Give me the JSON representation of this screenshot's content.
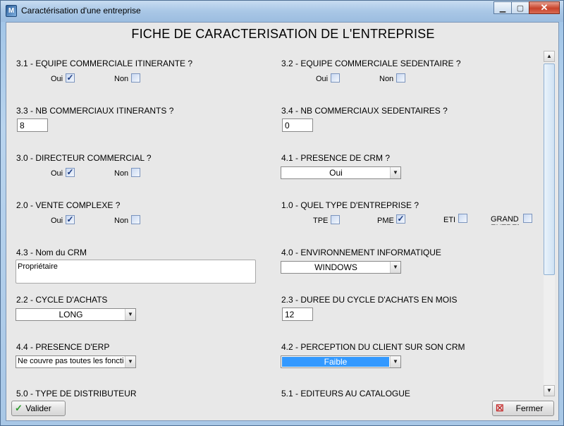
{
  "window": {
    "title": "Caractérisation d'une entreprise",
    "app_icon_text": "M"
  },
  "heading": "FICHE DE CARACTERISATION DE L'ENTREPRISE",
  "common": {
    "oui": "Oui",
    "non": "Non"
  },
  "q31": {
    "label": "3.1 - EQUIPE COMMERCIALE ITINERANTE ?",
    "oui_checked": true,
    "non_checked": false
  },
  "q32": {
    "label": "3.2 - EQUIPE COMMERCIALE SEDENTAIRE ?",
    "oui_checked": false,
    "non_checked": false
  },
  "q33": {
    "label": "3.3 - NB COMMERCIAUX ITINERANTS ?",
    "value": "8"
  },
  "q34": {
    "label": "3.4 - NB COMMERCIAUX SEDENTAIRES ?",
    "value": "0"
  },
  "q30": {
    "label": "3.0 - DIRECTEUR COMMERCIAL ?",
    "oui_checked": true,
    "non_checked": false
  },
  "q41": {
    "label": "4.1 - PRESENCE DE CRM ?",
    "value": "Oui"
  },
  "q20": {
    "label": "2.0 - VENTE COMPLEXE ?",
    "oui_checked": true,
    "non_checked": false
  },
  "q10": {
    "label": "1.0 - QUEL TYPE D'ENTREPRISE ?",
    "options": [
      "TPE",
      "PME",
      "ETI",
      "GRANDE ENTREPRISE"
    ],
    "checked": [
      false,
      true,
      false,
      false
    ]
  },
  "q43": {
    "label": "4.3 - Nom du CRM",
    "value": "Propriétaire"
  },
  "q40": {
    "label": "4.0 - ENVIRONNEMENT INFORMATIQUE",
    "value": "WINDOWS"
  },
  "q22": {
    "label": "2.2 - CYCLE D'ACHATS",
    "value": "LONG"
  },
  "q23": {
    "label": "2.3 - DUREE DU CYCLE D'ACHATS EN MOIS",
    "value": "12"
  },
  "q44": {
    "label": "4.4 - PRESENCE D'ERP",
    "value": "Ne couvre pas toutes les fonctions"
  },
  "q42": {
    "label": "4.2 - PERCEPTION DU CLIENT SUR SON CRM",
    "value": "Faible"
  },
  "q50": {
    "label": "5.0 - TYPE DE DISTRIBUTEUR"
  },
  "q51": {
    "label": "5.1 - EDITEURS AU CATALOGUE"
  },
  "buttons": {
    "valider": "Valider",
    "fermer": "Fermer"
  }
}
